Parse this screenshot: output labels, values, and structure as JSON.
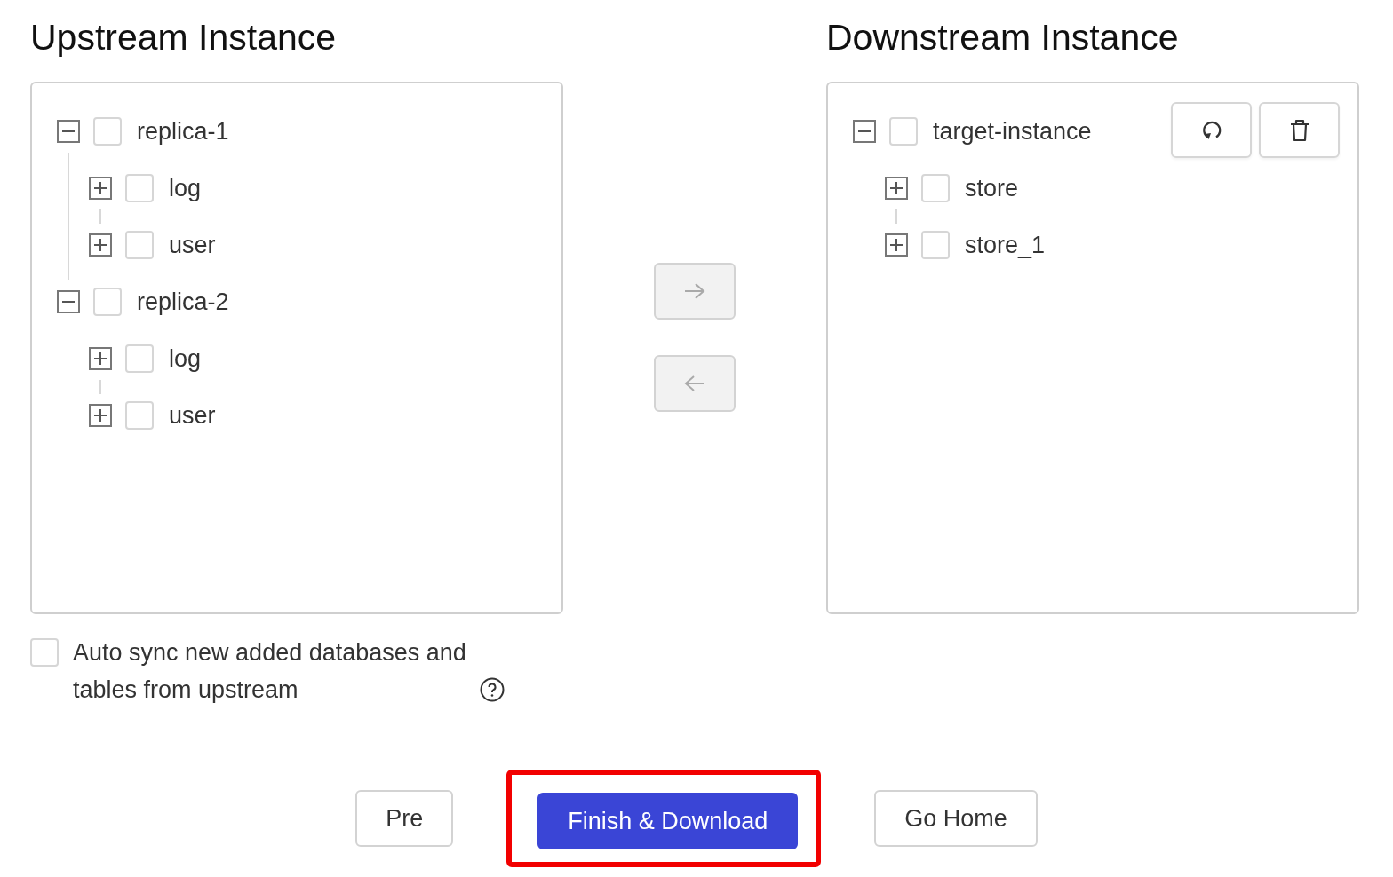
{
  "upstream": {
    "title": "Upstream Instance",
    "nodes": [
      {
        "label": "replica-1",
        "expanded": true,
        "checked": false,
        "children": [
          {
            "label": "log",
            "expanded": false,
            "checked": false
          },
          {
            "label": "user",
            "expanded": false,
            "checked": false
          }
        ]
      },
      {
        "label": "replica-2",
        "expanded": true,
        "checked": false,
        "children": [
          {
            "label": "log",
            "expanded": false,
            "checked": false
          },
          {
            "label": "user",
            "expanded": false,
            "checked": false
          }
        ]
      }
    ]
  },
  "transfer_buttons": [
    {
      "kind": "right",
      "disabled": true
    },
    {
      "kind": "left",
      "disabled": true
    }
  ],
  "downstream": {
    "title": "Downstream Instance",
    "nodes": [
      {
        "label": "target-instance",
        "expanded": true,
        "checked": false,
        "children": [
          {
            "label": "store",
            "expanded": false,
            "checked": false
          },
          {
            "label": "store_1",
            "expanded": false,
            "checked": false
          }
        ]
      }
    ],
    "tools": [
      {
        "kind": "refresh"
      },
      {
        "kind": "delete"
      }
    ]
  },
  "auto_sync": {
    "label": "Auto sync new added databases and tables from upstream",
    "checked": false
  },
  "footer_buttons": [
    {
      "label": "Pre",
      "primary": false,
      "highlighted": false
    },
    {
      "label": "Finish & Download",
      "primary": true,
      "highlighted": true
    },
    {
      "label": "Go Home",
      "primary": false,
      "highlighted": false
    }
  ]
}
